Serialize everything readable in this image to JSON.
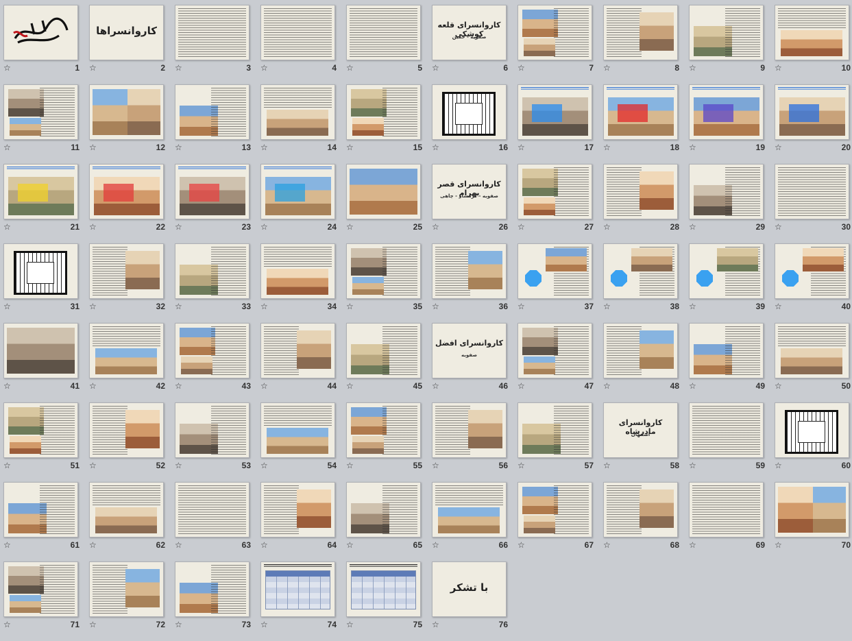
{
  "colors": {
    "background": "#c9ccd1",
    "slide": "#efece1",
    "accent_blue": "#2a6fd6"
  },
  "star_icon": "star-outline-icon",
  "slides": [
    {
      "number": "1",
      "kind": "calligraphy",
      "title": "",
      "subtitle": ""
    },
    {
      "number": "2",
      "kind": "title",
      "title": "کاروانسراها",
      "subtitle": ""
    },
    {
      "number": "3",
      "kind": "text",
      "title": "",
      "subtitle": ""
    },
    {
      "number": "4",
      "kind": "text",
      "title": "",
      "subtitle": ""
    },
    {
      "number": "5",
      "kind": "text",
      "title": "",
      "subtitle": ""
    },
    {
      "number": "6",
      "kind": "title-small",
      "title": "کاروانسرای قلعه کوشکی",
      "subtitle": "صفویه - خمین"
    },
    {
      "number": "7",
      "kind": "photo-text",
      "title": "",
      "subtitle": ""
    },
    {
      "number": "8",
      "kind": "photo-text",
      "title": "",
      "subtitle": ""
    },
    {
      "number": "9",
      "kind": "photo-text",
      "title": "",
      "subtitle": ""
    },
    {
      "number": "10",
      "kind": "photo-text",
      "title": "",
      "subtitle": ""
    },
    {
      "number": "11",
      "kind": "photo-text",
      "title": "",
      "subtitle": ""
    },
    {
      "number": "12",
      "kind": "photo",
      "title": "",
      "subtitle": ""
    },
    {
      "number": "13",
      "kind": "photo-text",
      "title": "",
      "subtitle": ""
    },
    {
      "number": "14",
      "kind": "photo-text",
      "title": "",
      "subtitle": ""
    },
    {
      "number": "15",
      "kind": "photo-text",
      "title": "",
      "subtitle": ""
    },
    {
      "number": "16",
      "kind": "plan",
      "title": "",
      "subtitle": ""
    },
    {
      "number": "17",
      "kind": "aerial",
      "title": "",
      "subtitle": ""
    },
    {
      "number": "18",
      "kind": "aerial",
      "title": "",
      "subtitle": ""
    },
    {
      "number": "19",
      "kind": "aerial",
      "title": "",
      "subtitle": ""
    },
    {
      "number": "20",
      "kind": "aerial",
      "title": "",
      "subtitle": ""
    },
    {
      "number": "21",
      "kind": "aerial",
      "title": "",
      "subtitle": ""
    },
    {
      "number": "22",
      "kind": "aerial",
      "title": "",
      "subtitle": ""
    },
    {
      "number": "23",
      "kind": "aerial",
      "title": "",
      "subtitle": ""
    },
    {
      "number": "24",
      "kind": "aerial",
      "title": "",
      "subtitle": ""
    },
    {
      "number": "25",
      "kind": "photo",
      "title": "",
      "subtitle": ""
    },
    {
      "number": "26",
      "kind": "title-small",
      "title": "کاروانسرای قصر بهرام",
      "subtitle": "صفویه - گرمسار - چاهی"
    },
    {
      "number": "27",
      "kind": "photo-text",
      "title": "",
      "subtitle": ""
    },
    {
      "number": "28",
      "kind": "photo-text",
      "title": "",
      "subtitle": ""
    },
    {
      "number": "29",
      "kind": "photo-text",
      "title": "",
      "subtitle": ""
    },
    {
      "number": "30",
      "kind": "text",
      "title": "",
      "subtitle": ""
    },
    {
      "number": "31",
      "kind": "plan",
      "title": "",
      "subtitle": ""
    },
    {
      "number": "32",
      "kind": "photo-text",
      "title": "",
      "subtitle": ""
    },
    {
      "number": "33",
      "kind": "photo-text",
      "title": "",
      "subtitle": ""
    },
    {
      "number": "34",
      "kind": "photo-text",
      "title": "",
      "subtitle": ""
    },
    {
      "number": "35",
      "kind": "photo-text",
      "title": "",
      "subtitle": ""
    },
    {
      "number": "36",
      "kind": "photo-text",
      "title": "",
      "subtitle": ""
    },
    {
      "number": "37",
      "kind": "octagon",
      "title": "",
      "subtitle": ""
    },
    {
      "number": "38",
      "kind": "octagon",
      "title": "",
      "subtitle": ""
    },
    {
      "number": "39",
      "kind": "octagon",
      "title": "",
      "subtitle": ""
    },
    {
      "number": "40",
      "kind": "octagon",
      "title": "",
      "subtitle": ""
    },
    {
      "number": "41",
      "kind": "photo",
      "title": "",
      "subtitle": ""
    },
    {
      "number": "42",
      "kind": "photo-text",
      "title": "",
      "subtitle": ""
    },
    {
      "number": "43",
      "kind": "photo-text",
      "title": "",
      "subtitle": ""
    },
    {
      "number": "44",
      "kind": "photo-text",
      "title": "",
      "subtitle": ""
    },
    {
      "number": "45",
      "kind": "photo-text",
      "title": "",
      "subtitle": ""
    },
    {
      "number": "46",
      "kind": "title-small",
      "title": "کاروانسرای افضل",
      "subtitle": "صفویه"
    },
    {
      "number": "47",
      "kind": "photo-text",
      "title": "",
      "subtitle": ""
    },
    {
      "number": "48",
      "kind": "photo-text",
      "title": "",
      "subtitle": ""
    },
    {
      "number": "49",
      "kind": "photo-text",
      "title": "",
      "subtitle": ""
    },
    {
      "number": "50",
      "kind": "photo-text",
      "title": "",
      "subtitle": ""
    },
    {
      "number": "51",
      "kind": "photo-text",
      "title": "",
      "subtitle": ""
    },
    {
      "number": "52",
      "kind": "photo-text",
      "title": "",
      "subtitle": ""
    },
    {
      "number": "53",
      "kind": "photo-text",
      "title": "",
      "subtitle": ""
    },
    {
      "number": "54",
      "kind": "photo-text",
      "title": "",
      "subtitle": ""
    },
    {
      "number": "55",
      "kind": "photo-text",
      "title": "",
      "subtitle": ""
    },
    {
      "number": "56",
      "kind": "photo-text",
      "title": "",
      "subtitle": ""
    },
    {
      "number": "57",
      "kind": "photo-text",
      "title": "",
      "subtitle": ""
    },
    {
      "number": "58",
      "kind": "title-small",
      "title": "کاروانسرای مادرشاه",
      "subtitle": "اصفهان"
    },
    {
      "number": "59",
      "kind": "text",
      "title": "",
      "subtitle": ""
    },
    {
      "number": "60",
      "kind": "plan",
      "title": "",
      "subtitle": ""
    },
    {
      "number": "61",
      "kind": "photo-text",
      "title": "",
      "subtitle": ""
    },
    {
      "number": "62",
      "kind": "photo-text",
      "title": "",
      "subtitle": ""
    },
    {
      "number": "63",
      "kind": "text",
      "title": "",
      "subtitle": ""
    },
    {
      "number": "64",
      "kind": "photo-text",
      "title": "",
      "subtitle": ""
    },
    {
      "number": "65",
      "kind": "photo-text",
      "title": "",
      "subtitle": ""
    },
    {
      "number": "66",
      "kind": "photo-text",
      "title": "",
      "subtitle": ""
    },
    {
      "number": "67",
      "kind": "photo-text",
      "title": "",
      "subtitle": ""
    },
    {
      "number": "68",
      "kind": "photo-text",
      "title": "",
      "subtitle": ""
    },
    {
      "number": "69",
      "kind": "text",
      "title": "",
      "subtitle": ""
    },
    {
      "number": "70",
      "kind": "photo",
      "title": "",
      "subtitle": ""
    },
    {
      "number": "71",
      "kind": "photo-text",
      "title": "",
      "subtitle": ""
    },
    {
      "number": "72",
      "kind": "photo-text",
      "title": "",
      "subtitle": ""
    },
    {
      "number": "73",
      "kind": "photo-text",
      "title": "",
      "subtitle": ""
    },
    {
      "number": "74",
      "kind": "table",
      "title": "",
      "subtitle": ""
    },
    {
      "number": "75",
      "kind": "table",
      "title": "",
      "subtitle": ""
    },
    {
      "number": "76",
      "kind": "title",
      "title": "با تشکر",
      "subtitle": ""
    }
  ]
}
